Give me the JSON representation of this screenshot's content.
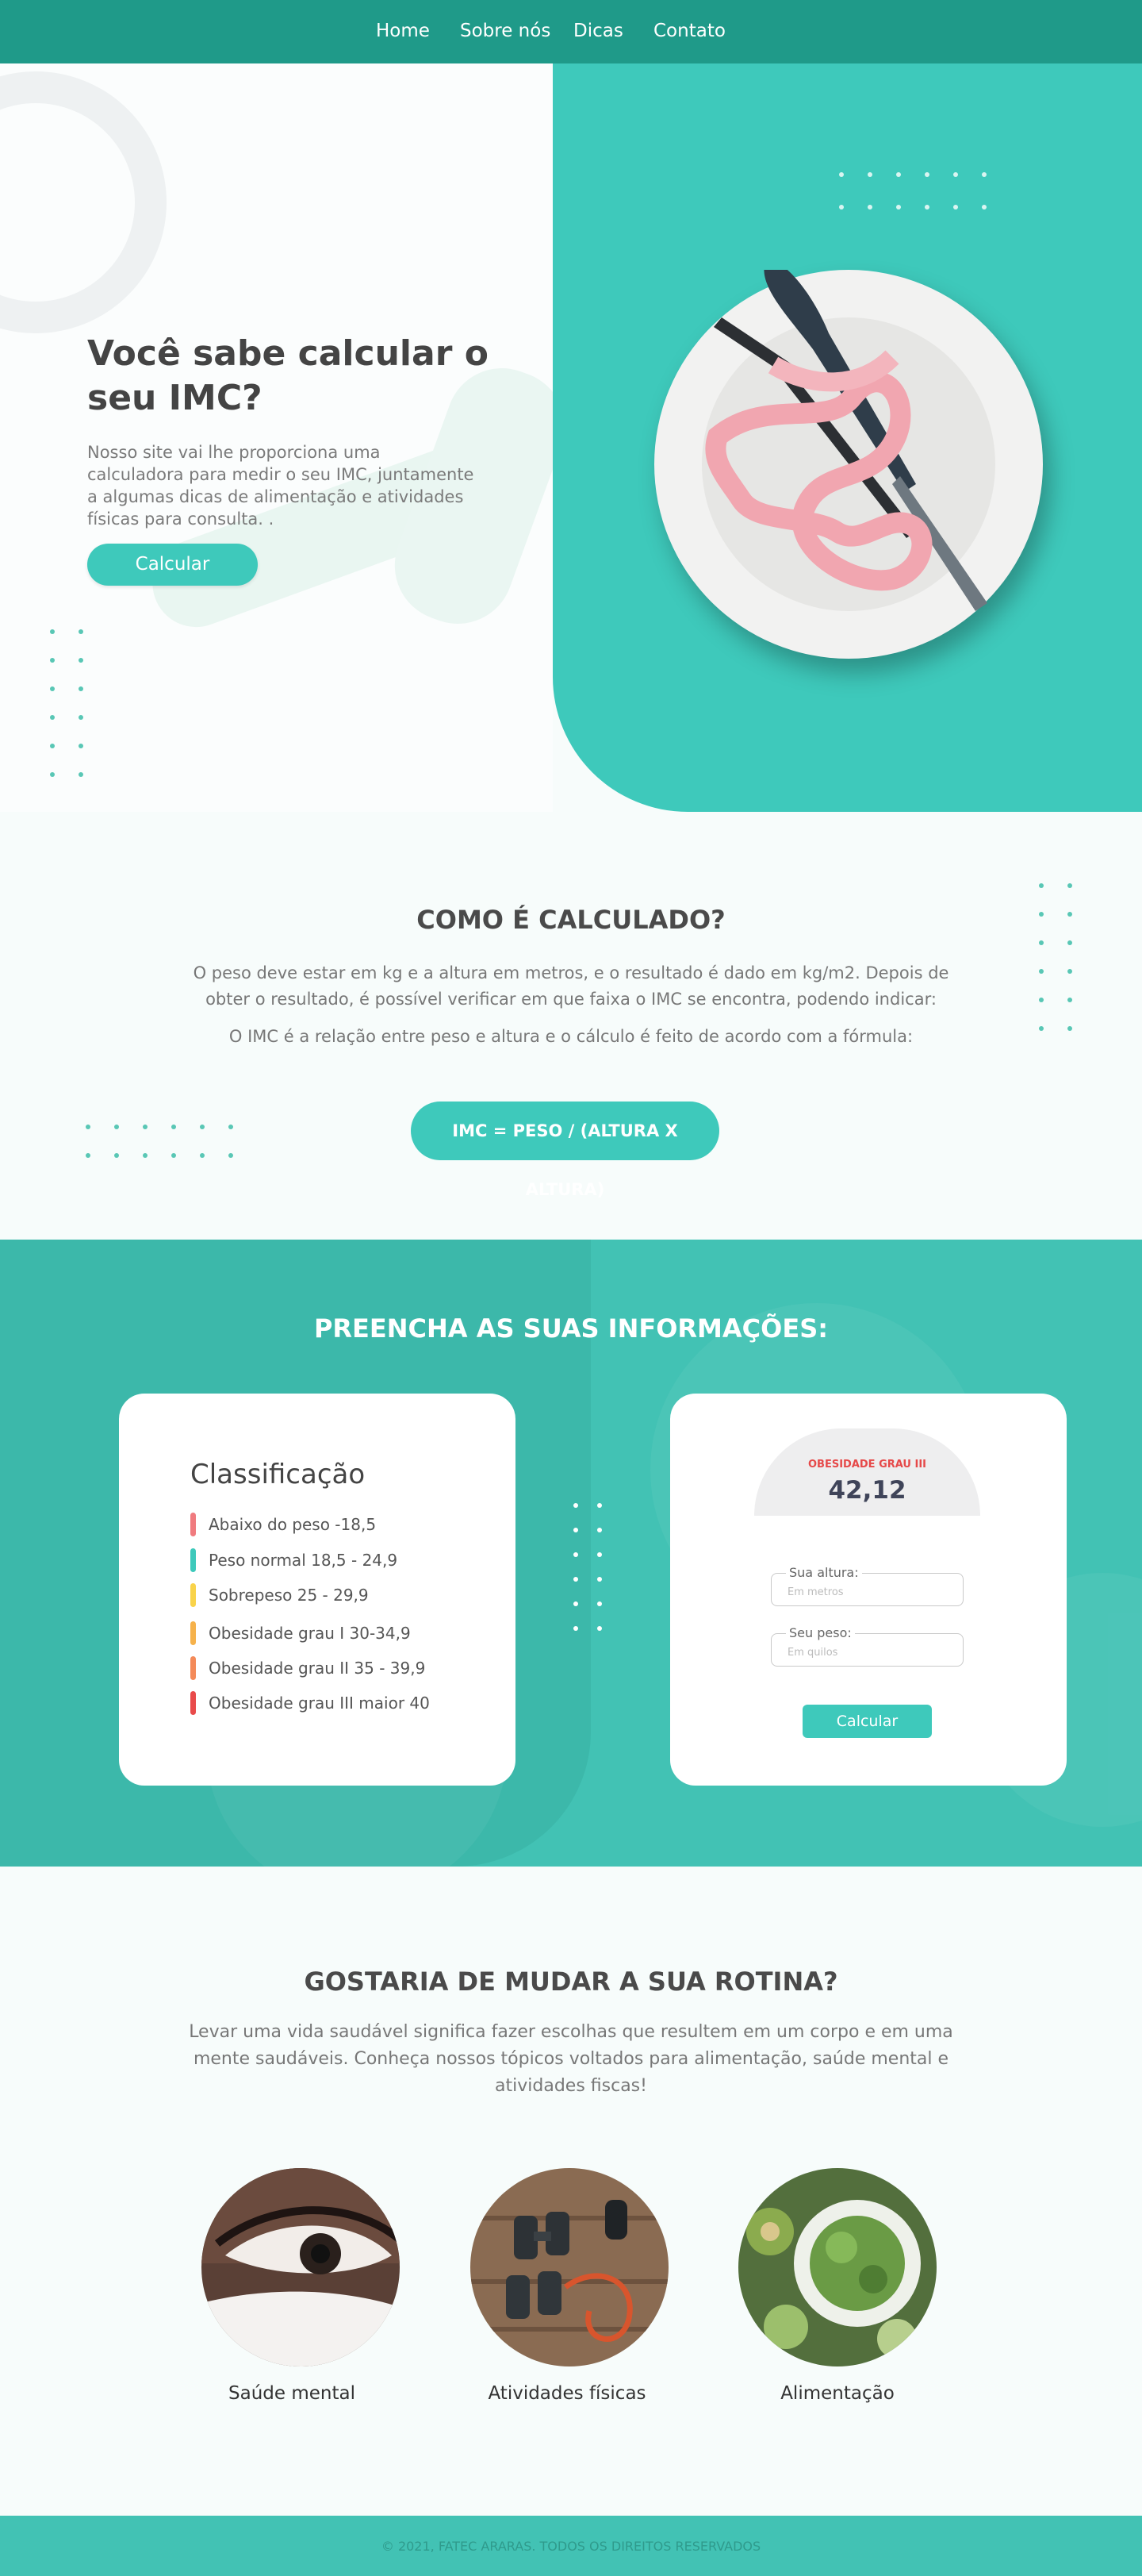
{
  "nav": {
    "items": [
      "Home",
      "Sobre nós",
      "Dicas",
      "Contato"
    ]
  },
  "hero": {
    "title": "Você sabe  calcular o seu IMC?",
    "text": "Nosso site vai lhe proporciona uma calculadora para medir o seu IMC, juntamente a algumas dicas de alimentação e atividades físicas para consulta. .",
    "button": "Calcular"
  },
  "how": {
    "title": "COMO É CALCULADO?",
    "paragraph1": "O peso deve estar em kg e a altura em metros, e o resultado é dado em kg/m2. Depois de obter o resultado, é possível verificar em que faixa o IMC se encontra, podendo indicar:",
    "paragraph2": "O IMC é a relação entre peso e altura e o cálculo é feito de acordo com a fórmula:",
    "formula": "IMC = PESO / (ALTURA X ALTURA)"
  },
  "form_section": {
    "title": "PREENCHA AS SUAS INFORMAÇÕES:"
  },
  "classification": {
    "title": "Classificação",
    "items": [
      {
        "label": "Abaixo do peso -18,5",
        "color": "#f07b7f"
      },
      {
        "label": "Peso normal 18,5 - 24,9",
        "color": "#3ec9bb"
      },
      {
        "label": "Sobrepeso 25 - 29,9",
        "color": "#f9d34a"
      },
      {
        "label": "Obesidade grau I 30-34,9",
        "color": "#f6b24b"
      },
      {
        "label": " Obesidade grau II 35 - 39,9",
        "color": "#f48a59"
      },
      {
        "label": "Obesidade grau III maior 40",
        "color": "#e94b4b"
      }
    ]
  },
  "calculator": {
    "result_label": "OBESIDADE GRAU III",
    "result_value": "42,12",
    "height_label": "Sua altura:",
    "height_placeholder": "Em metros",
    "weight_label": "Seu peso:",
    "weight_placeholder": "Em quilos",
    "button": "Calcular"
  },
  "routine": {
    "title": "GOSTARIA DE MUDAR A SUA ROTINA?",
    "text": "Levar uma vida saudável significa fazer escolhas que resultem em um corpo e em uma mente saudáveis. Conheça nossos tópicos voltados para alimentação, saúde mental e atividades fiscas!",
    "topics": [
      "Saúde mental",
      "Atividades físicas",
      "Alimentação"
    ]
  },
  "footer": {
    "text": "© 2021, FATEC ARARAS. TODOS OS DIREITOS RESERVADOS"
  },
  "colors": {
    "primary": "#3ec9bb",
    "nav": "#1f9a89",
    "alert": "#e64949"
  }
}
